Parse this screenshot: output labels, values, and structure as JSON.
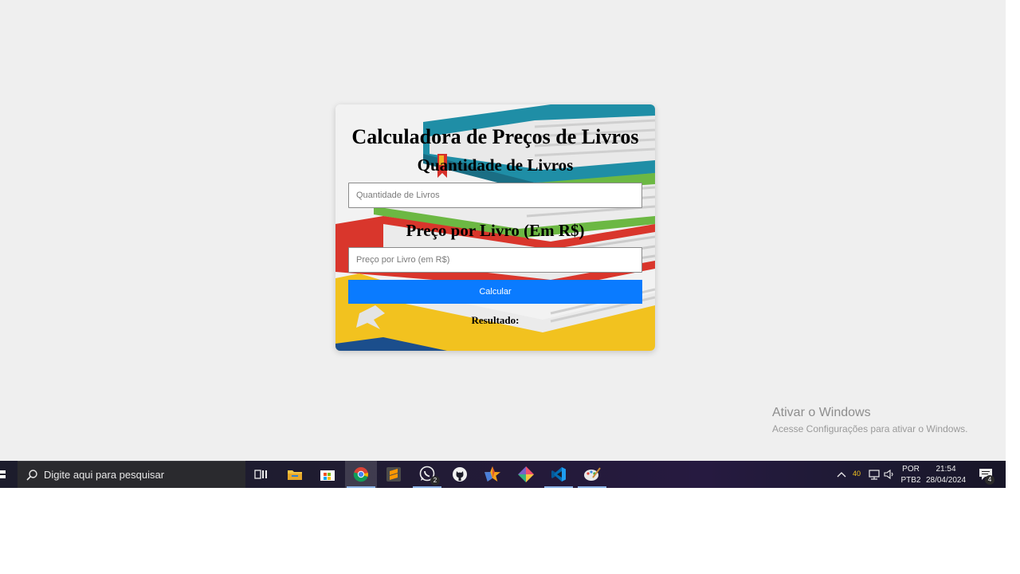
{
  "calculator": {
    "title": "Calculadora de Preços de Livros",
    "quantity_label": "Quantidade de Livros",
    "quantity_placeholder": "Quantidade de Livros",
    "quantity_value": "",
    "price_label": "Preço por Livro (Em R$)",
    "price_placeholder": "Preço por Livro (em R$)",
    "price_value": "",
    "button_label": "Calcular",
    "result_label": "Resultado:"
  },
  "watermark": {
    "title": "Ativar o Windows",
    "subtitle": "Acesse Configurações para ativar o Windows."
  },
  "taskbar": {
    "search_placeholder": "Digite aqui para pesquisar",
    "apps": [
      {
        "name": "task-view",
        "icon": "task-view-icon"
      },
      {
        "name": "file-explorer",
        "icon": "folder-icon"
      },
      {
        "name": "microsoft-store",
        "icon": "store-icon"
      },
      {
        "name": "chrome",
        "icon": "chrome-icon",
        "active": true
      },
      {
        "name": "sublime-text",
        "icon": "sublime-icon"
      },
      {
        "name": "whatsapp",
        "icon": "whatsapp-icon",
        "badge": "2"
      },
      {
        "name": "github-desktop",
        "icon": "github-icon"
      },
      {
        "name": "starred-app",
        "icon": "star-icon"
      },
      {
        "name": "git",
        "icon": "git-icon"
      },
      {
        "name": "vscode",
        "icon": "vscode-icon"
      },
      {
        "name": "paint",
        "icon": "palette-icon"
      }
    ],
    "tray_temp": "40",
    "language_line1": "POR",
    "language_line2": "PTB2",
    "time": "21:54",
    "date": "28/04/2024",
    "notification_count": "4"
  },
  "colors": {
    "button": "#0a7bff",
    "desktop": "#efefef",
    "accent_underline": "#8cb4e8"
  }
}
